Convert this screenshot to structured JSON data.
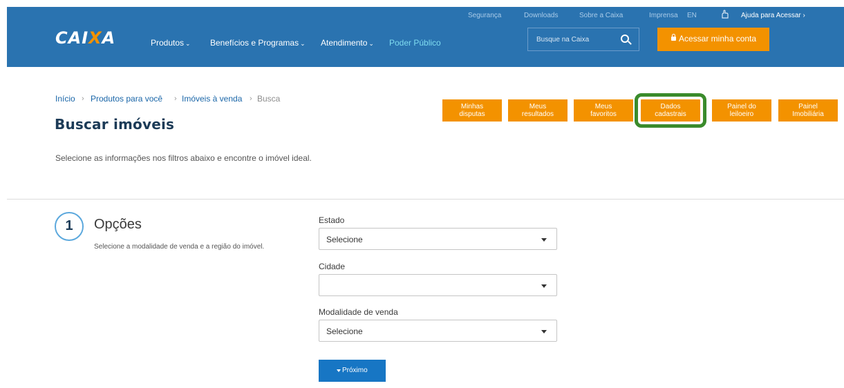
{
  "colors": {
    "header_bg": "#2a73b0",
    "accent_orange": "#f39200",
    "highlight_green": "#3a8b2b",
    "primary_button": "#1776c4"
  },
  "header": {
    "top_links": [
      "Segurança",
      "Downloads",
      "Sobre a Caixa",
      "Imprensa",
      "EN"
    ],
    "help_link": "Ajuda para Acessar ›",
    "logo": {
      "part1": "CAI",
      "part2": "X",
      "part3": "A"
    },
    "nav": {
      "produtos": "Produtos",
      "beneficios": "Benefícios e Programas",
      "atendimento": "Atendimento",
      "poder_publico": "Poder Público"
    },
    "search_placeholder": "Busque na Caixa",
    "access_button": "Acessar minha conta"
  },
  "breadcrumb": {
    "items": [
      "Início",
      "Produtos para você",
      "Imóveis à venda"
    ],
    "separator": "›",
    "current": "Busca"
  },
  "page": {
    "title": "Buscar imóveis",
    "intro": "Selecione as informações nos filtros abaixo e encontre o imóvel ideal."
  },
  "tabs": [
    {
      "line1": "Minhas",
      "line2": "disputas"
    },
    {
      "line1": "Meus",
      "line2": "resultados"
    },
    {
      "line1": "Meus",
      "line2": "favoritos"
    },
    {
      "line1": "Dados",
      "line2": "cadastrais"
    },
    {
      "line1": "Painel do",
      "line2": "leiloeiro"
    },
    {
      "line1": "Painel",
      "line2": "Imobiliária"
    }
  ],
  "step": {
    "number": "1",
    "title": "Opções",
    "description": "Selecione a modalidade de venda e a região do imóvel."
  },
  "form": {
    "estado": {
      "label": "Estado",
      "value": "Selecione"
    },
    "cidade": {
      "label": "Cidade",
      "value": ""
    },
    "modalidade": {
      "label": "Modalidade de venda",
      "value": "Selecione"
    },
    "next_button": "Próximo"
  }
}
